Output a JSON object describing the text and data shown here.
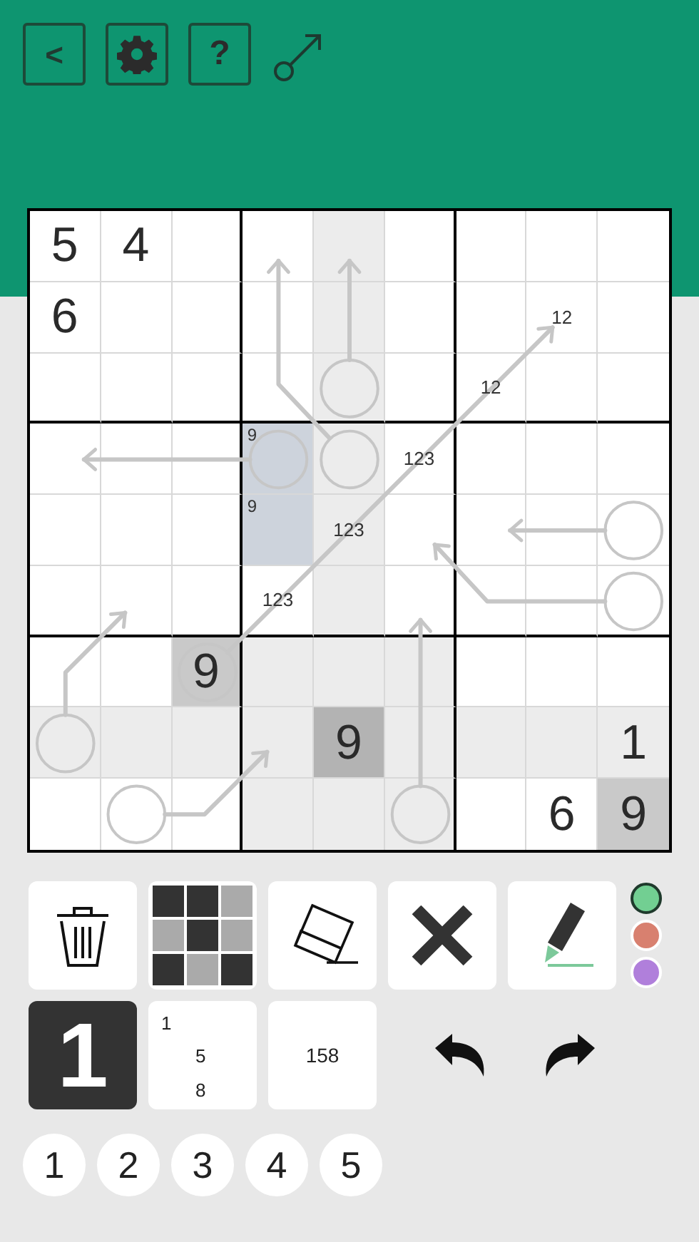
{
  "header": {
    "back_label": "<",
    "help_label": "?"
  },
  "grid": {
    "rows": [
      [
        {
          "value": "5",
          "color": "#ffffff"
        },
        {
          "value": "4",
          "color": "#ffffff"
        },
        {
          "color": "#ffffff"
        },
        {
          "color": "#ffffff"
        },
        {
          "color": "#ececec"
        },
        {
          "color": "#ffffff"
        },
        {
          "color": "#ffffff"
        },
        {
          "color": "#ffffff"
        },
        {
          "color": "#ffffff"
        }
      ],
      [
        {
          "value": "6",
          "color": "#ffffff"
        },
        {
          "color": "#ffffff"
        },
        {
          "color": "#ffffff"
        },
        {
          "color": "#ffffff"
        },
        {
          "color": "#ececec"
        },
        {
          "color": "#ffffff"
        },
        {
          "color": "#ffffff"
        },
        {
          "marks": "12",
          "kind": "center",
          "color": "#ffffff"
        },
        {
          "color": "#ffffff"
        }
      ],
      [
        {
          "color": "#ffffff"
        },
        {
          "color": "#ffffff"
        },
        {
          "color": "#ffffff"
        },
        {
          "color": "#ffffff"
        },
        {
          "color": "#ececec"
        },
        {
          "color": "#ffffff"
        },
        {
          "marks": "12",
          "kind": "center",
          "color": "#ffffff"
        },
        {
          "color": "#ffffff"
        },
        {
          "color": "#ffffff"
        }
      ],
      [
        {
          "color": "#ffffff"
        },
        {
          "color": "#ffffff"
        },
        {
          "color": "#ffffff"
        },
        {
          "marks": "9",
          "kind": "corner",
          "color": "#cdd3dc"
        },
        {
          "color": "#ececec"
        },
        {
          "marks": "123",
          "kind": "center",
          "color": "#ffffff"
        },
        {
          "color": "#ffffff"
        },
        {
          "color": "#ffffff"
        },
        {
          "color": "#ffffff"
        }
      ],
      [
        {
          "color": "#ffffff"
        },
        {
          "color": "#ffffff"
        },
        {
          "color": "#ffffff"
        },
        {
          "marks": "9",
          "kind": "corner",
          "color": "#cdd3dc"
        },
        {
          "marks": "123",
          "kind": "center",
          "color": "#ececec"
        },
        {
          "color": "#ffffff"
        },
        {
          "color": "#ffffff"
        },
        {
          "color": "#ffffff"
        },
        {
          "color": "#ffffff"
        }
      ],
      [
        {
          "color": "#ffffff"
        },
        {
          "color": "#ffffff"
        },
        {
          "color": "#ffffff"
        },
        {
          "marks": "123",
          "kind": "center",
          "color": "#ffffff"
        },
        {
          "color": "#ececec"
        },
        {
          "color": "#ffffff"
        },
        {
          "color": "#ffffff"
        },
        {
          "color": "#ffffff"
        },
        {
          "color": "#ffffff"
        }
      ],
      [
        {
          "color": "#ffffff"
        },
        {
          "color": "#ffffff"
        },
        {
          "value": "9",
          "color": "#c9c9c9"
        },
        {
          "color": "#ececec"
        },
        {
          "color": "#ececec"
        },
        {
          "color": "#ececec"
        },
        {
          "color": "#ffffff"
        },
        {
          "color": "#ffffff"
        },
        {
          "color": "#ffffff"
        }
      ],
      [
        {
          "color": "#ececec"
        },
        {
          "color": "#ececec"
        },
        {
          "color": "#ececec"
        },
        {
          "color": "#ececec"
        },
        {
          "value": "9",
          "color": "#b3b3b3"
        },
        {
          "color": "#ececec"
        },
        {
          "color": "#ececec"
        },
        {
          "color": "#ececec"
        },
        {
          "value": "1",
          "color": "#ececec"
        }
      ],
      [
        {
          "color": "#ffffff"
        },
        {
          "color": "#ffffff"
        },
        {
          "color": "#ffffff"
        },
        {
          "color": "#ececec"
        },
        {
          "color": "#ececec"
        },
        {
          "color": "#ececec"
        },
        {
          "color": "#ffffff"
        },
        {
          "value": "6",
          "color": "#ffffff"
        },
        {
          "value": "9",
          "color": "#c9c9c9"
        }
      ]
    ]
  },
  "colors": [
    {
      "color": "#72cf92",
      "selected": true
    },
    {
      "color": "#d8806f",
      "selected": false
    },
    {
      "color": "#b07fdb",
      "selected": false
    }
  ],
  "modes": [
    {
      "kind": "normal",
      "label": "1",
      "selected": true
    },
    {
      "kind": "corner",
      "marks": [
        "1",
        "5",
        "8"
      ],
      "selected": false
    },
    {
      "kind": "center",
      "label": "158",
      "selected": false
    }
  ],
  "numbers": [
    "1",
    "2",
    "3",
    "4",
    "5"
  ]
}
